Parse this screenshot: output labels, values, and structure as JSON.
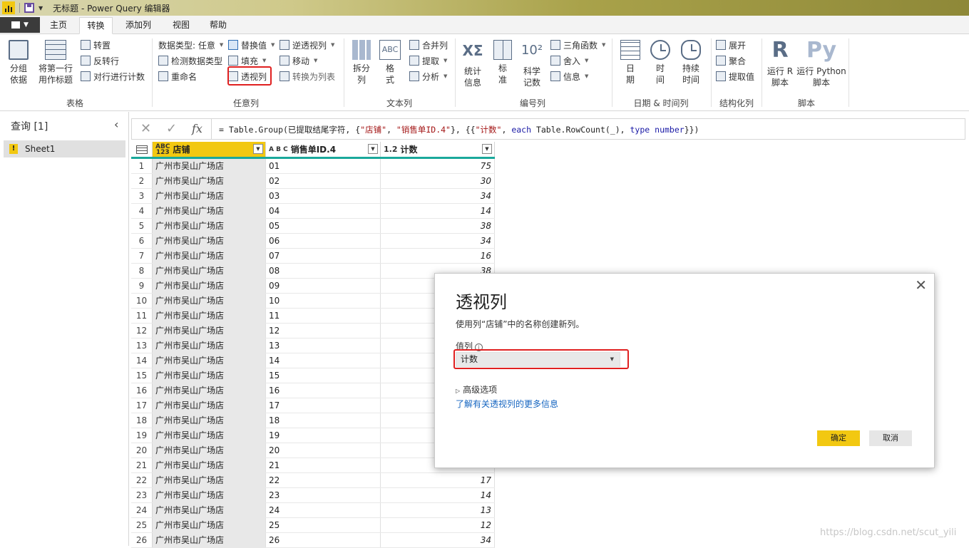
{
  "window": {
    "title": "无标题 - Power Query 编辑器"
  },
  "tabs": [
    {
      "label": "主页"
    },
    {
      "label": "转换"
    },
    {
      "label": "添加列"
    },
    {
      "label": "视图"
    },
    {
      "label": "帮助"
    }
  ],
  "ribbon": {
    "table": {
      "label": "表格",
      "group_by": "分组\n依据",
      "use_first_row": "将第一行\n用作标题",
      "transpose": "转置",
      "reverse_rows": "反转行",
      "count_rows": "对行进行计数"
    },
    "any_column": {
      "label": "任意列",
      "data_type": "数据类型: 任意",
      "detect_type": "检测数据类型",
      "rename": "重命名",
      "replace_values": "替换值",
      "fill": "填充",
      "pivot_column": "透视列",
      "unpivot": "逆透视列",
      "move": "移动",
      "convert_to_list": "转换为列表"
    },
    "text_column": {
      "label": "文本列",
      "split": "拆分\n列",
      "format": "格\n式",
      "merge": "合并列",
      "extract": "提取",
      "parse": "分析"
    },
    "number_column": {
      "label": "编号列",
      "statistics": "统计\n信息",
      "standard": "标\n准",
      "scientific": "科学\n记数",
      "trig": "三角函数",
      "rounding": "舍入",
      "information": "信息"
    },
    "datetime": {
      "label": "日期 & 时间列",
      "date": "日\n期",
      "time": "时\n间",
      "duration": "持续\n时间"
    },
    "structured": {
      "label": "结构化列",
      "expand": "展开",
      "aggregate": "聚合",
      "extract_values": "提取值"
    },
    "scripts": {
      "label": "脚本",
      "run_r": "运行 R\n脚本",
      "run_python": "运行 Python\n脚本"
    }
  },
  "queries": {
    "title": "查询 [1]",
    "items": [
      {
        "name": "Sheet1"
      }
    ]
  },
  "formula": {
    "prefix": "= Table.Group(已提取结尾字符, {",
    "s1": "\"店铺\"",
    "c1": ", ",
    "s2": "\"销售单ID.4\"",
    "c2": "}, {{",
    "s3": "\"计数\"",
    "c3": ", ",
    "kw1": "each",
    "c4": " Table.RowCount(_), ",
    "kw2": "type",
    "c5": " ",
    "kw3": "number",
    "suffix": "}})"
  },
  "grid": {
    "columns": [
      {
        "type": "ABC\n123",
        "name": "店铺"
      },
      {
        "type": "A B C",
        "name": "销售单ID.4"
      },
      {
        "type": "1.2",
        "name": "计数"
      }
    ],
    "rows": [
      [
        "1",
        "广州市吴山广场店",
        "01",
        "75"
      ],
      [
        "2",
        "广州市吴山广场店",
        "02",
        "30"
      ],
      [
        "3",
        "广州市吴山广场店",
        "03",
        "34"
      ],
      [
        "4",
        "广州市吴山广场店",
        "04",
        "14"
      ],
      [
        "5",
        "广州市吴山广场店",
        "05",
        "38"
      ],
      [
        "6",
        "广州市吴山广场店",
        "06",
        "34"
      ],
      [
        "7",
        "广州市吴山广场店",
        "07",
        "16"
      ],
      [
        "8",
        "广州市吴山广场店",
        "08",
        "38"
      ],
      [
        "9",
        "广州市吴山广场店",
        "09",
        ""
      ],
      [
        "10",
        "广州市吴山广场店",
        "10",
        ""
      ],
      [
        "11",
        "广州市吴山广场店",
        "11",
        ""
      ],
      [
        "12",
        "广州市吴山广场店",
        "12",
        ""
      ],
      [
        "13",
        "广州市吴山广场店",
        "13",
        ""
      ],
      [
        "14",
        "广州市吴山广场店",
        "14",
        ""
      ],
      [
        "15",
        "广州市吴山广场店",
        "15",
        ""
      ],
      [
        "16",
        "广州市吴山广场店",
        "16",
        ""
      ],
      [
        "17",
        "广州市吴山广场店",
        "17",
        ""
      ],
      [
        "18",
        "广州市吴山广场店",
        "18",
        ""
      ],
      [
        "19",
        "广州市吴山广场店",
        "19",
        ""
      ],
      [
        "20",
        "广州市吴山广场店",
        "20",
        ""
      ],
      [
        "21",
        "广州市吴山广场店",
        "21",
        ""
      ],
      [
        "22",
        "广州市吴山广场店",
        "22",
        "17"
      ],
      [
        "23",
        "广州市吴山广场店",
        "23",
        "14"
      ],
      [
        "24",
        "广州市吴山广场店",
        "24",
        "13"
      ],
      [
        "25",
        "广州市吴山广场店",
        "25",
        "12"
      ],
      [
        "26",
        "广州市吴山广场店",
        "26",
        "34"
      ]
    ]
  },
  "dialog": {
    "title": "透视列",
    "description": "使用列“店铺”中的名称创建新列。",
    "value_column_label": "值列",
    "value_column_selected": "计数",
    "advanced": "高级选项",
    "learn_more": "了解有关透视列的更多信息",
    "ok": "确定",
    "cancel": "取消"
  },
  "watermark": "https://blog.csdn.net/scut_yili"
}
